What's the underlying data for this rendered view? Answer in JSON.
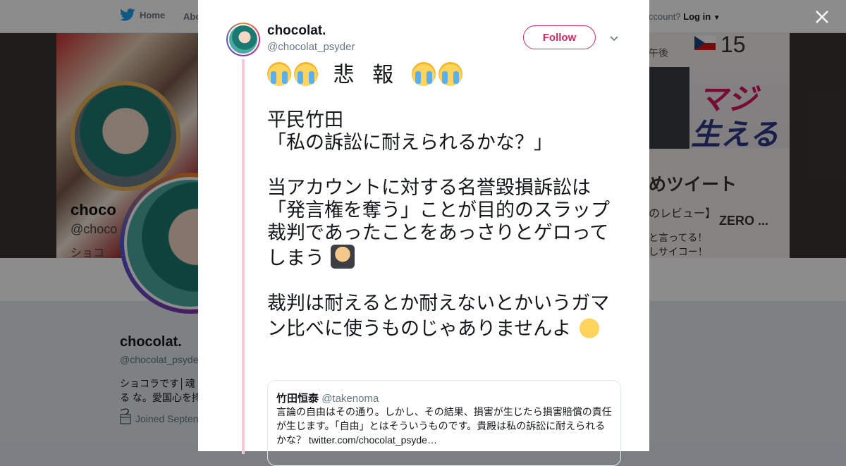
{
  "nav": {
    "home": "Home",
    "about": "Abo",
    "account_prompt": "ccount?",
    "login": "Log in"
  },
  "banner": {
    "right_time": "午後",
    "right_number": "15",
    "right_big1": "マジ",
    "right_big2": "生える",
    "right_note1": "めツイート",
    "right_note2": "のレビュー】",
    "right_note3": "ZERO ...",
    "right_note4": "と言ってる！",
    "right_note5": "しサイコー！",
    "left_title": "choco",
    "left_handle": "@choco",
    "left_sub": "ショコ"
  },
  "profile": {
    "name": "chocolat.",
    "handle": "@chocolat_psyde",
    "bio": "ショコラです│魂る な。愛国心を持つ",
    "joined": "Joined Septen"
  },
  "modal": {
    "author_name": "chocolat.",
    "author_handle": "@chocolat_psyder",
    "follow_label": "Follow",
    "tweet": {
      "heading_text": "悲 報",
      "line1": "平民竹田",
      "line2": "「私の訴訟に耐えられるかな？」",
      "line3": "当アカウントに対する名誉毀損訴訟は「発言権を奪う」ことが目的のスラップ裁判であったことをあっさりとゲロってしまう",
      "line4": "裁判は耐えるとか耐えないとかいうガマン比べに使うものじゃありませんよ"
    },
    "quote": {
      "author": "竹田恒泰",
      "handle": "@takenoma",
      "text": "言論の自由はその通り。しかし、その結果、損害が生じたら損害賠償の責任が生じます。「自由」とはそういうものです。貴殿は私の訴訟に耐えられるかな？ twitter.com/chocolat_psyde…"
    }
  },
  "colors": {
    "accent_pink": "#e0245e",
    "thread_line": "#f9c7d5",
    "text_secondary": "#657786"
  },
  "icons": [
    "twitter-bird-icon",
    "close-icon",
    "chevron-down-icon",
    "calendar-icon",
    "loudly-crying-face-emoji",
    "detective-emoji",
    "raised-hand-emoji"
  ]
}
